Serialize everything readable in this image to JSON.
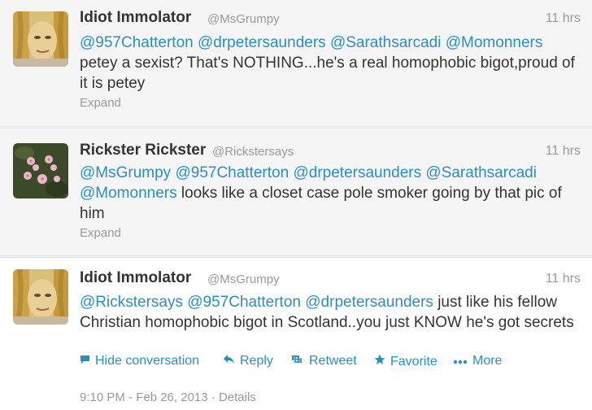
{
  "tweets": [
    {
      "fullname": "Idiot Immolator",
      "username": "@MsGrumpy",
      "time": "11 hrs",
      "mentions": [
        "@957Chatterton",
        "@drpetersaunders",
        "@Sarathsarcadi",
        "@Momonners"
      ],
      "body": "petey a sexist? That's NOTHING...he's a real homophobic bigot,proud of it is petey",
      "expand": "Expand"
    },
    {
      "fullname": "Rickster Rickster",
      "username": "@Rickstersays",
      "time": "11 hrs",
      "mentions": [
        "@MsGrumpy",
        "@957Chatterton",
        "@drpetersaunders",
        "@Sarathsarcadi",
        "@Momonners"
      ],
      "body": "looks like a closet case pole smoker going by that pic of him",
      "expand": "Expand"
    },
    {
      "fullname": "Idiot Immolator",
      "username": "@MsGrumpy",
      "time": "11 hrs",
      "mentions": [
        "@Rickstersays",
        "@957Chatterton",
        "@drpetersaunders"
      ],
      "body": "just like his fellow Christian homophobic bigot in Scotland..you just KNOW he's got secrets",
      "actions": {
        "hide_conversation": "Hide conversation",
        "reply": "Reply",
        "retweet": "Retweet",
        "favorite": "Favorite",
        "more": "More"
      },
      "timestamp": "9:10 PM - Feb 26, 2013",
      "separator": "·",
      "details": "Details"
    }
  ],
  "icons": {
    "hide_conversation": "speech-bubble-icon",
    "reply": "reply-arrow-icon",
    "retweet": "retweet-icon",
    "favorite": "star-icon",
    "more": "ellipsis-icon"
  },
  "colors": {
    "link": "#2a8ec2",
    "meta": "#999999",
    "text": "#333333",
    "background": "#f5f5f5",
    "expanded_background": "#ffffff"
  }
}
